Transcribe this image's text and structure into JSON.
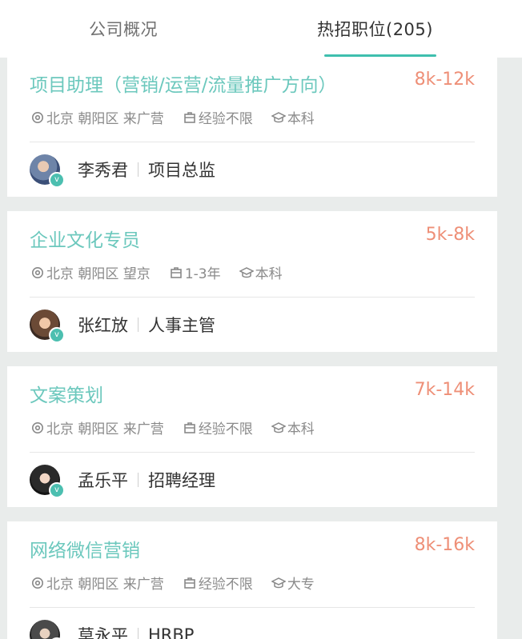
{
  "tabs": [
    {
      "label": "公司概况"
    },
    {
      "label": "热招职位(205)"
    }
  ],
  "jobs": [
    {
      "title": "项目助理（营销/运营/流量推广方向）",
      "salary": "8k-12k",
      "location": "北京 朝阳区 来广营",
      "experience": "经验不限",
      "education": "本科",
      "recruiter": "李秀君",
      "role": "项目总监"
    },
    {
      "title": "企业文化专员",
      "salary": "5k-8k",
      "location": "北京 朝阳区 望京",
      "experience": "1-3年",
      "education": "本科",
      "recruiter": "张红放",
      "role": "人事主管"
    },
    {
      "title": "文案策划",
      "salary": "7k-14k",
      "location": "北京 朝阳区 来广营",
      "experience": "经验不限",
      "education": "本科",
      "recruiter": "孟乐平",
      "role": "招聘经理"
    },
    {
      "title": "网络微信营销",
      "salary": "8k-16k",
      "location": "北京 朝阳区 来广营",
      "experience": "经验不限",
      "education": "大专",
      "recruiter": "莫永平",
      "role": "HRBP"
    }
  ],
  "icons": {
    "location": "location-pin-icon",
    "experience": "briefcase-icon",
    "education": "graduation-cap-icon",
    "verified": "verified-badge-icon"
  },
  "colors": {
    "accent": "#3fbfae",
    "title": "#6cc8bd",
    "salary": "#ee8f77",
    "background": "#e9eceb"
  }
}
